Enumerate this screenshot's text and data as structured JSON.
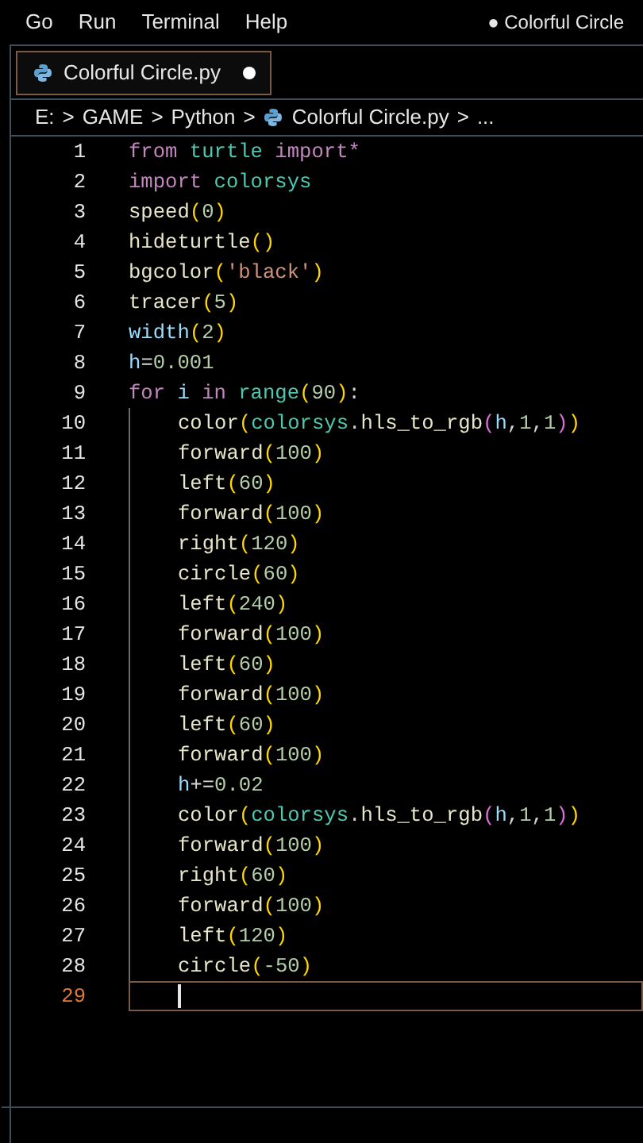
{
  "menu": [
    "Go",
    "Run",
    "Terminal",
    "Help"
  ],
  "window_title": "● Colorful Circle",
  "tabs": [
    {
      "label": "Colorful Circle.py",
      "selected": true,
      "modified": true
    }
  ],
  "breadcrumbs": [
    {
      "kind": "crumb",
      "text": "E:"
    },
    {
      "kind": "sep",
      "text": ">"
    },
    {
      "kind": "crumb",
      "text": "GAME"
    },
    {
      "kind": "sep",
      "text": ">"
    },
    {
      "kind": "crumb",
      "text": "Python"
    },
    {
      "kind": "sep",
      "text": ">"
    },
    {
      "kind": "file",
      "text": "Colorful Circle.py"
    },
    {
      "kind": "sep",
      "text": ">"
    },
    {
      "kind": "crumb",
      "text": "..."
    }
  ],
  "lines": [
    {
      "number": "1",
      "current": false,
      "tokens": [
        {
          "kind": "kw",
          "text": "from "
        },
        {
          "kind": "mod",
          "text": "turtle "
        },
        {
          "kind": "kw",
          "text": "import*"
        }
      ]
    },
    {
      "number": "2",
      "current": false,
      "tokens": [
        {
          "kind": "kw",
          "text": "import "
        },
        {
          "kind": "mod",
          "text": "colorsys"
        }
      ]
    },
    {
      "number": "3",
      "current": false,
      "tokens": [
        {
          "kind": "fn",
          "text": "speed"
        },
        {
          "kind": "p1",
          "text": "("
        },
        {
          "kind": "num",
          "text": "0"
        },
        {
          "kind": "p1",
          "text": ")"
        }
      ]
    },
    {
      "number": "4",
      "current": false,
      "tokens": [
        {
          "kind": "fn",
          "text": "hideturtle"
        },
        {
          "kind": "p1",
          "text": "()"
        }
      ]
    },
    {
      "number": "5",
      "current": false,
      "tokens": [
        {
          "kind": "fn",
          "text": "bgcolor"
        },
        {
          "kind": "p1",
          "text": "("
        },
        {
          "kind": "str",
          "text": "'black'"
        },
        {
          "kind": "p1",
          "text": ")"
        }
      ]
    },
    {
      "number": "6",
      "current": false,
      "tokens": [
        {
          "kind": "fn",
          "text": "tracer"
        },
        {
          "kind": "p1",
          "text": "("
        },
        {
          "kind": "num",
          "text": "5"
        },
        {
          "kind": "p1",
          "text": ")"
        }
      ]
    },
    {
      "number": "7",
      "current": false,
      "tokens": [
        {
          "kind": "var",
          "text": "width"
        },
        {
          "kind": "p1",
          "text": "("
        },
        {
          "kind": "num",
          "text": "2"
        },
        {
          "kind": "p1",
          "text": ")"
        }
      ]
    },
    {
      "number": "8",
      "current": false,
      "tokens": [
        {
          "kind": "var",
          "text": "h"
        },
        {
          "kind": "plain",
          "text": "="
        },
        {
          "kind": "num",
          "text": "0.001"
        }
      ]
    },
    {
      "number": "9",
      "current": false,
      "tokens": [
        {
          "kind": "kw",
          "text": "for "
        },
        {
          "kind": "var",
          "text": "i "
        },
        {
          "kind": "kw",
          "text": "in "
        },
        {
          "kind": "mod",
          "text": "range"
        },
        {
          "kind": "p1",
          "text": "("
        },
        {
          "kind": "num",
          "text": "90"
        },
        {
          "kind": "p1",
          "text": ")"
        },
        {
          "kind": "plain",
          "text": ":"
        }
      ],
      "children": [
        {
          "number": "10",
          "current": false,
          "tokens": [
            {
              "kind": "fn",
              "text": "color"
            },
            {
              "kind": "p1",
              "text": "("
            },
            {
              "kind": "mod",
              "text": "colorsys"
            },
            {
              "kind": "plain",
              "text": "."
            },
            {
              "kind": "fn",
              "text": "hls_to_rgb"
            },
            {
              "kind": "p2",
              "text": "("
            },
            {
              "kind": "var",
              "text": "h"
            },
            {
              "kind": "plain",
              "text": ","
            },
            {
              "kind": "num",
              "text": "1"
            },
            {
              "kind": "plain",
              "text": ","
            },
            {
              "kind": "num",
              "text": "1"
            },
            {
              "kind": "p2",
              "text": ")"
            },
            {
              "kind": "p1",
              "text": ")"
            }
          ]
        },
        {
          "number": "11",
          "current": false,
          "tokens": [
            {
              "kind": "fn",
              "text": "forward"
            },
            {
              "kind": "p1",
              "text": "("
            },
            {
              "kind": "num",
              "text": "100"
            },
            {
              "kind": "p1",
              "text": ")"
            }
          ]
        },
        {
          "number": "12",
          "current": false,
          "tokens": [
            {
              "kind": "fn",
              "text": "left"
            },
            {
              "kind": "p1",
              "text": "("
            },
            {
              "kind": "num",
              "text": "60"
            },
            {
              "kind": "p1",
              "text": ")"
            }
          ]
        },
        {
          "number": "13",
          "current": false,
          "tokens": [
            {
              "kind": "fn",
              "text": "forward"
            },
            {
              "kind": "p1",
              "text": "("
            },
            {
              "kind": "num",
              "text": "100"
            },
            {
              "kind": "p1",
              "text": ")"
            }
          ]
        },
        {
          "number": "14",
          "current": false,
          "tokens": [
            {
              "kind": "fn",
              "text": "right"
            },
            {
              "kind": "p1",
              "text": "("
            },
            {
              "kind": "num",
              "text": "120"
            },
            {
              "kind": "p1",
              "text": ")"
            }
          ]
        },
        {
          "number": "15",
          "current": false,
          "tokens": [
            {
              "kind": "fn",
              "text": "circle"
            },
            {
              "kind": "p1",
              "text": "("
            },
            {
              "kind": "num",
              "text": "60"
            },
            {
              "kind": "p1",
              "text": ")"
            }
          ]
        },
        {
          "number": "16",
          "current": false,
          "tokens": [
            {
              "kind": "fn",
              "text": "left"
            },
            {
              "kind": "p1",
              "text": "("
            },
            {
              "kind": "num",
              "text": "240"
            },
            {
              "kind": "p1",
              "text": ")"
            }
          ]
        },
        {
          "number": "17",
          "current": false,
          "tokens": [
            {
              "kind": "fn",
              "text": "forward"
            },
            {
              "kind": "p1",
              "text": "("
            },
            {
              "kind": "num",
              "text": "100"
            },
            {
              "kind": "p1",
              "text": ")"
            }
          ]
        },
        {
          "number": "18",
          "current": false,
          "tokens": [
            {
              "kind": "fn",
              "text": "left"
            },
            {
              "kind": "p1",
              "text": "("
            },
            {
              "kind": "num",
              "text": "60"
            },
            {
              "kind": "p1",
              "text": ")"
            }
          ]
        },
        {
          "number": "19",
          "current": false,
          "tokens": [
            {
              "kind": "fn",
              "text": "forward"
            },
            {
              "kind": "p1",
              "text": "("
            },
            {
              "kind": "num",
              "text": "100"
            },
            {
              "kind": "p1",
              "text": ")"
            }
          ]
        },
        {
          "number": "20",
          "current": false,
          "tokens": [
            {
              "kind": "fn",
              "text": "left"
            },
            {
              "kind": "p1",
              "text": "("
            },
            {
              "kind": "num",
              "text": "60"
            },
            {
              "kind": "p1",
              "text": ")"
            }
          ]
        },
        {
          "number": "21",
          "current": false,
          "tokens": [
            {
              "kind": "fn",
              "text": "forward"
            },
            {
              "kind": "p1",
              "text": "("
            },
            {
              "kind": "num",
              "text": "100"
            },
            {
              "kind": "p1",
              "text": ")"
            }
          ]
        },
        {
          "number": "22",
          "current": false,
          "tokens": [
            {
              "kind": "var",
              "text": "h"
            },
            {
              "kind": "plain",
              "text": "+="
            },
            {
              "kind": "num",
              "text": "0.02"
            }
          ]
        },
        {
          "number": "23",
          "current": false,
          "tokens": [
            {
              "kind": "fn",
              "text": "color"
            },
            {
              "kind": "p1",
              "text": "("
            },
            {
              "kind": "mod",
              "text": "colorsys"
            },
            {
              "kind": "plain",
              "text": "."
            },
            {
              "kind": "fn",
              "text": "hls_to_rgb"
            },
            {
              "kind": "p2",
              "text": "("
            },
            {
              "kind": "var",
              "text": "h"
            },
            {
              "kind": "plain",
              "text": ","
            },
            {
              "kind": "num",
              "text": "1"
            },
            {
              "kind": "plain",
              "text": ","
            },
            {
              "kind": "num",
              "text": "1"
            },
            {
              "kind": "p2",
              "text": ")"
            },
            {
              "kind": "p1",
              "text": ")"
            }
          ]
        },
        {
          "number": "24",
          "current": false,
          "tokens": [
            {
              "kind": "fn",
              "text": "forward"
            },
            {
              "kind": "p1",
              "text": "("
            },
            {
              "kind": "num",
              "text": "100"
            },
            {
              "kind": "p1",
              "text": ")"
            }
          ]
        },
        {
          "number": "25",
          "current": false,
          "tokens": [
            {
              "kind": "fn",
              "text": "right"
            },
            {
              "kind": "p1",
              "text": "("
            },
            {
              "kind": "num",
              "text": "60"
            },
            {
              "kind": "p1",
              "text": ")"
            }
          ]
        },
        {
          "number": "26",
          "current": false,
          "tokens": [
            {
              "kind": "fn",
              "text": "forward"
            },
            {
              "kind": "p1",
              "text": "("
            },
            {
              "kind": "num",
              "text": "100"
            },
            {
              "kind": "p1",
              "text": ")"
            }
          ]
        },
        {
          "number": "27",
          "current": false,
          "tokens": [
            {
              "kind": "fn",
              "text": "left"
            },
            {
              "kind": "p1",
              "text": "("
            },
            {
              "kind": "num",
              "text": "120"
            },
            {
              "kind": "p1",
              "text": ")"
            }
          ]
        },
        {
          "number": "28",
          "current": false,
          "tokens": [
            {
              "kind": "fn",
              "text": "circle"
            },
            {
              "kind": "p1",
              "text": "("
            },
            {
              "kind": "num",
              "text": "-50"
            },
            {
              "kind": "p1",
              "text": ")"
            }
          ]
        },
        {
          "number": "29",
          "current": true
        }
      ]
    }
  ]
}
